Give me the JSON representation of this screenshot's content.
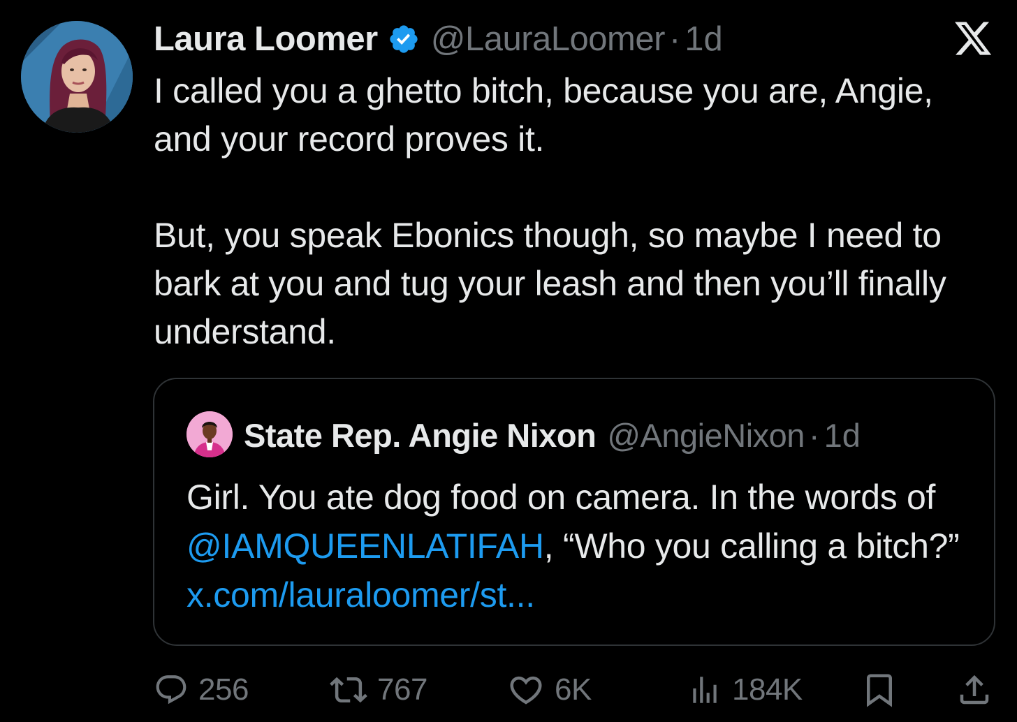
{
  "tweet": {
    "author_name": "Laura Loomer",
    "handle": "@LauraLoomer",
    "separator": "·",
    "time": "1d",
    "verified_color": "#1d9bf0",
    "text": "I called you a ghetto bitch, because you are, Angie, and your record proves it.\n\nBut, you speak Ebonics though, so maybe I need to bark at you and tug your leash and then you’ll finally understand."
  },
  "quote": {
    "author_name": "State Rep. Angie Nixon",
    "handle": "@AngieNixon",
    "separator": "·",
    "time": "1d",
    "text_part1": "Girl. You ate dog food on camera. In the words of ",
    "mention": "@IAMQUEENLATIFAH",
    "text_part2": ", “Who you calling a bitch?” ",
    "link": "x.com/lauraloomer/st..."
  },
  "actions": {
    "replies": "256",
    "reposts": "767",
    "likes": "6K",
    "views": "184K"
  },
  "colors": {
    "background": "#000000",
    "text": "#e7e9ea",
    "secondary": "#71767b",
    "accent": "#1d9bf0",
    "border": "#2f3336"
  }
}
